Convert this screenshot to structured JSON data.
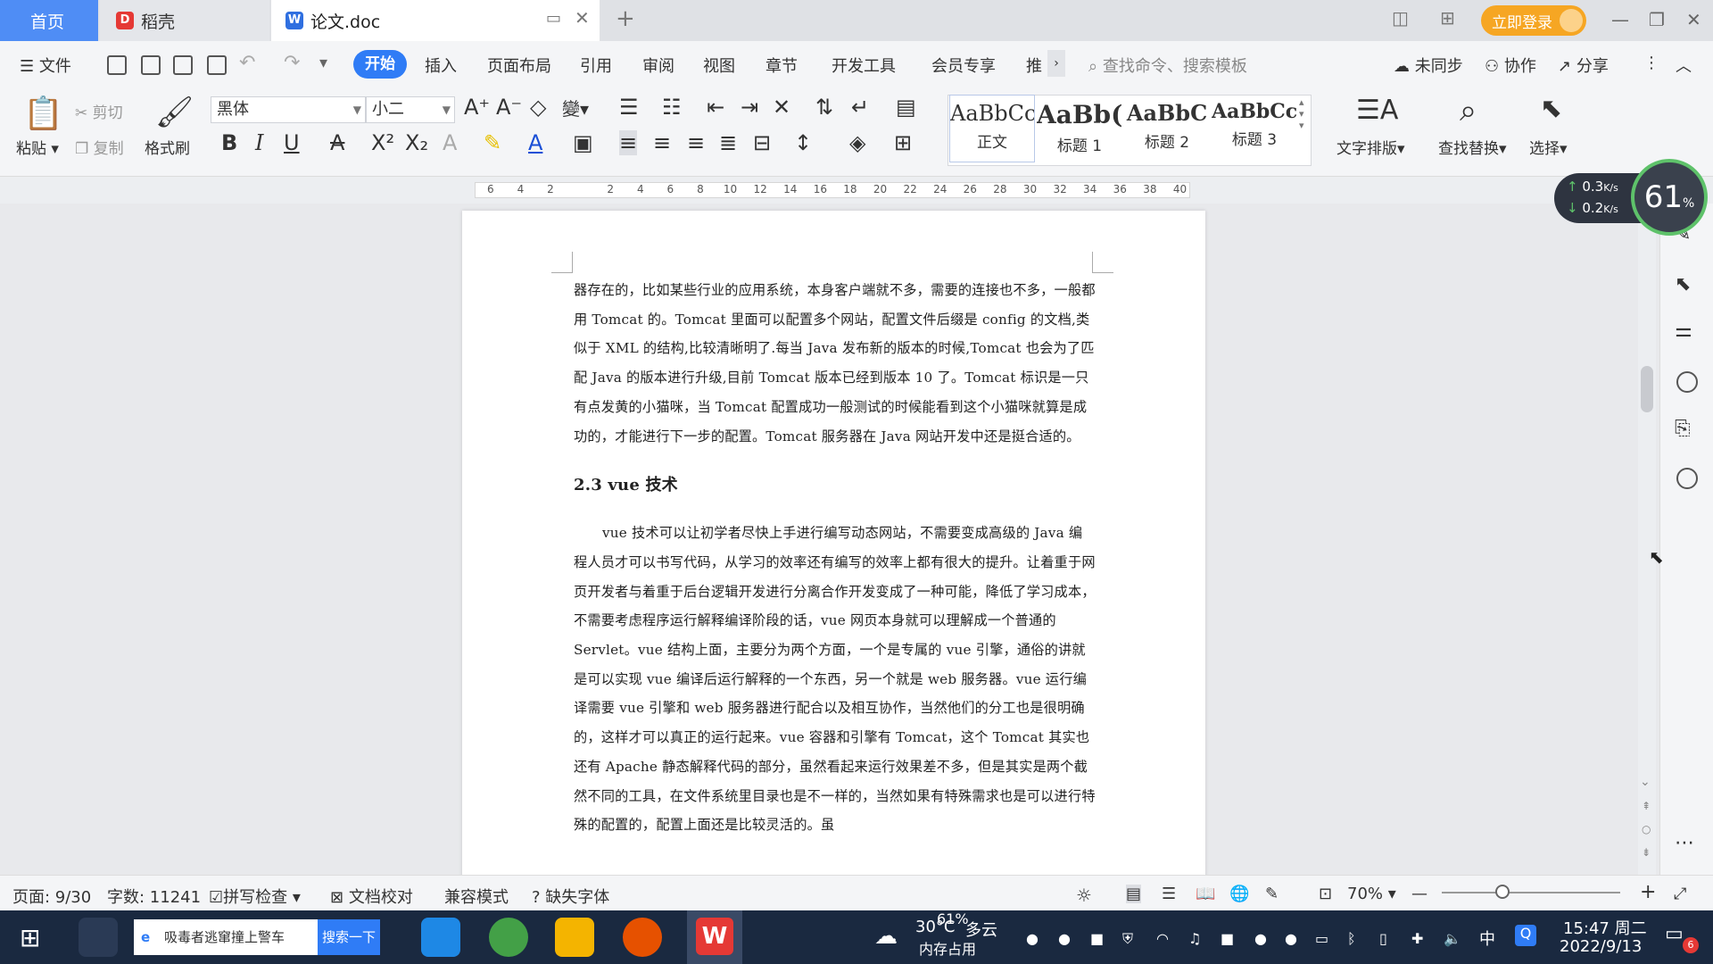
{
  "tabs": {
    "home": "首页",
    "daoke": "稻壳",
    "doc": "论文.doc"
  },
  "account": {
    "login": "立即登录"
  },
  "menu": {
    "file": "文件",
    "start": "开始",
    "insert": "插入",
    "layout": "页面布局",
    "ref": "引用",
    "review": "审阅",
    "view": "视图",
    "chapter": "章节",
    "dev": "开发工具",
    "member": "会员专享",
    "more": "推",
    "search_placeholder": "查找命令、搜索模板",
    "sync": "未同步",
    "collab": "协作",
    "share": "分享"
  },
  "ribbon": {
    "paste": "粘贴",
    "cut": "剪切",
    "copy": "复制",
    "format_painter": "格式刷",
    "font_name": "黑体",
    "font_size": "小二",
    "styles": [
      {
        "preview": "AaBbCcI",
        "name": "正文"
      },
      {
        "preview": "AaBb(",
        "name": "标题 1"
      },
      {
        "preview": "AaBbC",
        "name": "标题 2"
      },
      {
        "preview": "AaBbCcl",
        "name": "标题 3"
      }
    ],
    "text_layout": "文字排版",
    "find_replace": "查找替换",
    "select": "选择"
  },
  "ruler": [
    "6",
    "4",
    "2",
    "",
    "2",
    "4",
    "6",
    "8",
    "10",
    "12",
    "14",
    "16",
    "18",
    "20",
    "22",
    "24",
    "26",
    "28",
    "30",
    "32",
    "34",
    "36",
    "38",
    "40"
  ],
  "speed": {
    "up": "0.3",
    "down": "0.2",
    "unit": "K/s",
    "percent": "61",
    "percent_sign": "%"
  },
  "document": {
    "para1": "器存在的，比如某些行业的应用系统，本身客户端就不多，需要的连接也不多，一般都用 Tomcat 的。Tomcat 里面可以配置多个网站，配置文件后缀是 config 的文档,类似于 XML 的结构,比较清晰明了.每当 Java 发布新的版本的时候,Tomcat 也会为了匹配 Java 的版本进行升级,目前 Tomcat 版本已经到版本 10 了。Tomcat 标识是一只有点发黄的小猫咪，当 Tomcat 配置成功一般测试的时候能看到这个小猫咪就算是成功的，才能进行下一步的配置。Tomcat 服务器在 Java 网站开发中还是挺合适的。",
    "heading": "2.3 vue 技术",
    "para2": "vue 技术可以让初学者尽快上手进行编写动态网站，不需要变成高级的 Java 编程人员才可以书写代码，从学习的效率还有编写的效率上都有很大的提升。让着重于网页开发者与着重于后台逻辑开发进行分离合作开发变成了一种可能，降低了学习成本，不需要考虑程序运行解释编译阶段的话，vue 网页本身就可以理解成一个普通的 Servlet。vue 结构上面，主要分为两个方面，一个是专属的 vue 引擎，通俗的讲就是可以实现 vue 编译后运行解释的一个东西，另一个就是 web 服务器。vue 运行编译需要 vue 引擎和 web 服务器进行配合以及相互协作，当然他们的分工也是很明确的，这样才可以真正的运行起来。vue 容器和引擎有 Tomcat，这个 Tomcat 其实也还有 Apache 静态解释代码的部分，虽然看起来运行效果差不多，但是其实是两个截然不同的工具，在文件系统里目录也是不一样的，当然如果有特殊需求也是可以进行特殊的配置的，配置上面还是比较灵活的。虽"
  },
  "status": {
    "page": "页面: 9/30",
    "words": "字数: 11241",
    "spell": "拼写检查",
    "proof": "文档校对",
    "compat": "兼容模式",
    "missing_font": "缺失字体",
    "zoom": "70%"
  },
  "taskbar": {
    "search_text": "吸毒者逃窜撞上警车",
    "search_btn": "搜索一下",
    "weather_temp": "30°C",
    "weather_desc": "多云",
    "mem_pct": "61%",
    "mem_label": "内存占用",
    "ime": "中",
    "time": "15:47 周二",
    "date": "2022/9/13",
    "notif": "6"
  },
  "colors": {
    "accent": "#2f7cf6",
    "home_tab": "#4f8df5",
    "login": "#f6a623"
  }
}
